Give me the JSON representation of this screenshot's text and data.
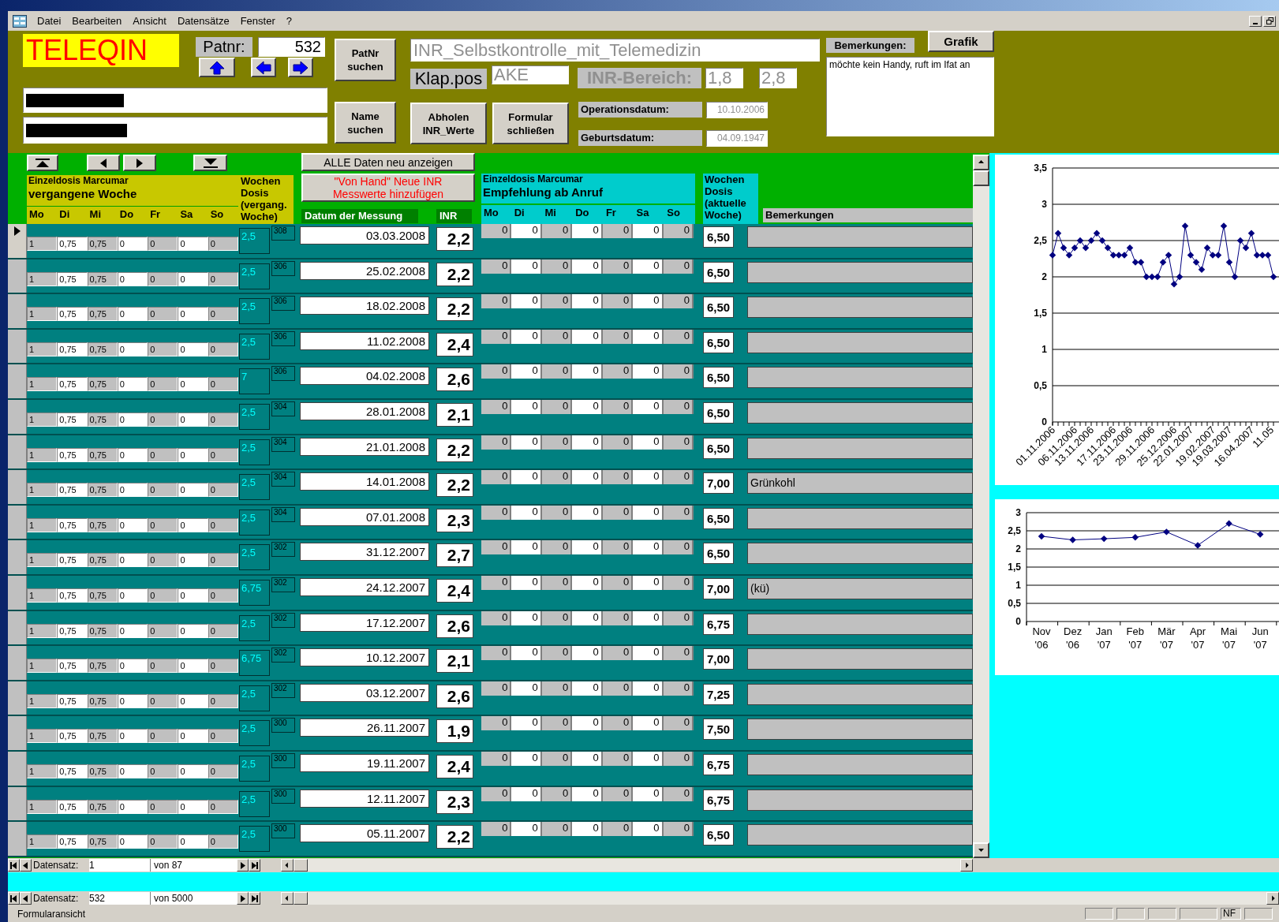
{
  "menu": [
    "Datei",
    "Bearbeiten",
    "Ansicht",
    "Datensätze",
    "Fenster",
    "?"
  ],
  "header": {
    "logo": "TELEQIN",
    "patnr_label": "Patnr:",
    "patnr": "532",
    "patnr_search": "PatNr suchen",
    "name_search": "Name suchen",
    "title": "INR_Selbstkontrolle_mit_Telemedizin",
    "klap_label": "Klap.pos",
    "klap": "AKE",
    "inr_range_label": "INR-Bereich:",
    "inr_min": "1,8",
    "inr_max": "2,8",
    "fetch_button": "Abholen INR_Werte",
    "close_button": "Formular schließen",
    "op_date_label": "Operationsdatum:",
    "op_date": "10.10.2006",
    "birth_label": "Geburtsdatum:",
    "birth_date": "04.09.1947",
    "remarks_label": "Bemerkungen:",
    "chart_button": "Grafik",
    "remarks": "möchte kein Handy, ruft im Ifat an"
  },
  "subform": {
    "show_all_button": "ALLE Daten neu anzeigen",
    "manual_button": "\"Von Hand\" Neue INR\nMesswerte  hinzufügen",
    "past_title": "Einzeldosis Marcumar",
    "past_subtitle": "vergangene Woche",
    "past_days": [
      "Mo",
      "Di",
      "Mi",
      "Do",
      "Fr",
      "Sa",
      "So"
    ],
    "weekly_past_header": "Wochen\nDosis\n(vergang.\nWoche)",
    "date_header": "Datum der Messung",
    "inr_header": "INR",
    "rec_title": "Einzeldosis Marcumar",
    "rec_subtitle": "Empfehlung ab Anruf",
    "rec_days": [
      "Mo",
      "Di",
      "Mi",
      "Do",
      "Fr",
      "Sa",
      "So"
    ],
    "weekly_header": "Wochen\nDosis\n(aktuelle\nWoche)",
    "remarks_header": "Bemerkungen",
    "rows": [
      {
        "selected": true,
        "past": [
          "1",
          "0,75",
          "0,75",
          "0",
          "0",
          "0",
          "0"
        ],
        "weekly_past": "2,5",
        "week_no": "308",
        "date": "03.03.2008",
        "inr": "2,2",
        "recommended": [
          "0",
          "0",
          "0",
          "0",
          "0",
          "0",
          "0"
        ],
        "weekly": "6,50"
      },
      {
        "selected": false,
        "past": [
          "1",
          "0,75",
          "0,75",
          "0",
          "0",
          "0",
          "0"
        ],
        "weekly_past": "2,5",
        "week_no": "306",
        "date": "25.02.2008",
        "inr": "2,2",
        "recommended": [
          "0",
          "0",
          "0",
          "0",
          "0",
          "0",
          "0"
        ],
        "weekly": "6,50"
      },
      {
        "selected": false,
        "past": [
          "1",
          "0,75",
          "0,75",
          "0",
          "0",
          "0",
          "0"
        ],
        "weekly_past": "2,5",
        "week_no": "306",
        "date": "18.02.2008",
        "inr": "2,2",
        "recommended": [
          "0",
          "0",
          "0",
          "0",
          "0",
          "0",
          "0"
        ],
        "weekly": "6,50"
      },
      {
        "selected": false,
        "past": [
          "1",
          "0,75",
          "0,75",
          "0",
          "0",
          "0",
          "0"
        ],
        "weekly_past": "2,5",
        "week_no": "306",
        "date": "11.02.2008",
        "inr": "2,4",
        "recommended": [
          "0",
          "0",
          "0",
          "0",
          "0",
          "0",
          "0"
        ],
        "weekly": "6,50"
      },
      {
        "selected": false,
        "past": [
          "1",
          "0,75",
          "0,75",
          "0",
          "0",
          "0",
          "0"
        ],
        "weekly_past": "7",
        "week_no": "306",
        "date": "04.02.2008",
        "inr": "2,6",
        "recommended": [
          "0",
          "0",
          "0",
          "0",
          "0",
          "0",
          "0"
        ],
        "weekly": "6,50"
      },
      {
        "selected": false,
        "past": [
          "1",
          "0,75",
          "0,75",
          "0",
          "0",
          "0",
          "0"
        ],
        "weekly_past": "2,5",
        "week_no": "304",
        "date": "28.01.2008",
        "inr": "2,1",
        "recommended": [
          "0",
          "0",
          "0",
          "0",
          "0",
          "0",
          "0"
        ],
        "weekly": "6,50"
      },
      {
        "selected": false,
        "past": [
          "1",
          "0,75",
          "0,75",
          "0",
          "0",
          "0",
          "0"
        ],
        "weekly_past": "2,5",
        "week_no": "304",
        "date": "21.01.2008",
        "inr": "2,2",
        "recommended": [
          "0",
          "0",
          "0",
          "0",
          "0",
          "0",
          "0"
        ],
        "weekly": "6,50"
      },
      {
        "selected": false,
        "past": [
          "1",
          "0,75",
          "0,75",
          "0",
          "0",
          "0",
          "0"
        ],
        "weekly_past": "2,5",
        "week_no": "304",
        "date": "14.01.2008",
        "inr": "2,2",
        "recommended": [
          "0",
          "0",
          "0",
          "0",
          "0",
          "0",
          "0"
        ],
        "weekly": "7,00",
        "remark": "Grünkohl"
      },
      {
        "selected": false,
        "past": [
          "1",
          "0,75",
          "0,75",
          "0",
          "0",
          "0",
          "0"
        ],
        "weekly_past": "2,5",
        "week_no": "304",
        "date": "07.01.2008",
        "inr": "2,3",
        "recommended": [
          "0",
          "0",
          "0",
          "0",
          "0",
          "0",
          "0"
        ],
        "weekly": "6,50"
      },
      {
        "selected": false,
        "past": [
          "1",
          "0,75",
          "0,75",
          "0",
          "0",
          "0",
          "0"
        ],
        "weekly_past": "2,5",
        "week_no": "302",
        "date": "31.12.2007",
        "inr": "2,7",
        "recommended": [
          "0",
          "0",
          "0",
          "0",
          "0",
          "0",
          "0"
        ],
        "weekly": "6,50"
      },
      {
        "selected": false,
        "past": [
          "1",
          "0,75",
          "0,75",
          "0",
          "0",
          "0",
          "0"
        ],
        "weekly_past": "6,75",
        "week_no": "302",
        "date": "24.12.2007",
        "inr": "2,4",
        "recommended": [
          "0",
          "0",
          "0",
          "0",
          "0",
          "0",
          "0"
        ],
        "weekly": "7,00",
        "remark": "(kü)"
      },
      {
        "selected": false,
        "past": [
          "1",
          "0,75",
          "0,75",
          "0",
          "0",
          "0",
          "0"
        ],
        "weekly_past": "2,5",
        "week_no": "302",
        "date": "17.12.2007",
        "inr": "2,6",
        "recommended": [
          "0",
          "0",
          "0",
          "0",
          "0",
          "0",
          "0"
        ],
        "weekly": "6,75"
      },
      {
        "selected": false,
        "past": [
          "1",
          "0,75",
          "0,75",
          "0",
          "0",
          "0",
          "0"
        ],
        "weekly_past": "6,75",
        "week_no": "302",
        "date": "10.12.2007",
        "inr": "2,1",
        "recommended": [
          "0",
          "0",
          "0",
          "0",
          "0",
          "0",
          "0"
        ],
        "weekly": "7,00"
      },
      {
        "selected": false,
        "past": [
          "1",
          "0,75",
          "0,75",
          "0",
          "0",
          "0",
          "0"
        ],
        "weekly_past": "2,5",
        "week_no": "302",
        "date": "03.12.2007",
        "inr": "2,6",
        "recommended": [
          "0",
          "0",
          "0",
          "0",
          "0",
          "0",
          "0"
        ],
        "weekly": "7,25"
      },
      {
        "selected": false,
        "past": [
          "1",
          "0,75",
          "0,75",
          "0",
          "0",
          "0",
          "0"
        ],
        "weekly_past": "2,5",
        "week_no": "300",
        "date": "26.11.2007",
        "inr": "1,9",
        "recommended": [
          "0",
          "0",
          "0",
          "0",
          "0",
          "0",
          "0"
        ],
        "weekly": "7,50"
      },
      {
        "selected": false,
        "past": [
          "1",
          "0,75",
          "0,75",
          "0",
          "0",
          "0",
          "0"
        ],
        "weekly_past": "2,5",
        "week_no": "300",
        "date": "19.11.2007",
        "inr": "2,4",
        "recommended": [
          "0",
          "0",
          "0",
          "0",
          "0",
          "0",
          "0"
        ],
        "weekly": "6,75"
      },
      {
        "selected": false,
        "past": [
          "1",
          "0,75",
          "0,75",
          "0",
          "0",
          "0",
          "0"
        ],
        "weekly_past": "2,5",
        "week_no": "300",
        "date": "12.11.2007",
        "inr": "2,3",
        "recommended": [
          "0",
          "0",
          "0",
          "0",
          "0",
          "0",
          "0"
        ],
        "weekly": "6,75"
      },
      {
        "selected": false,
        "past": [
          "1",
          "0,75",
          "0,75",
          "0",
          "0",
          "0",
          "0"
        ],
        "weekly_past": "2,5",
        "week_no": "300",
        "date": "05.11.2007",
        "inr": "2,2",
        "recommended": [
          "0",
          "0",
          "0",
          "0",
          "0",
          "0",
          "0"
        ],
        "weekly": "6,50"
      }
    ],
    "nav": {
      "label": "Datensatz:",
      "record": "1",
      "of": "von 87"
    }
  },
  "charts": [
    {
      "chart_data": {
        "type": "line",
        "grid": true,
        "ylim": [
          0,
          3.5
        ],
        "yticks": [
          {
            "value": 0,
            "label": "0"
          },
          {
            "value": 0.5,
            "label": "0,5"
          },
          {
            "value": 1,
            "label": "1"
          },
          {
            "value": 1.5,
            "label": "1,5"
          },
          {
            "value": 2,
            "label": "2"
          },
          {
            "value": 2.5,
            "label": "2,5"
          },
          {
            "value": 3,
            "label": "3"
          },
          {
            "value": 3.5,
            "label": "3,5"
          }
        ],
        "categories": [
          "01.11.2006",
          null,
          null,
          null,
          "06.11.2006",
          null,
          null,
          "13.11.2006",
          null,
          null,
          null,
          "17.11.2006",
          null,
          null,
          "23.11.2006",
          null,
          null,
          null,
          "29.11.2006",
          null,
          null,
          null,
          "25.12.2006",
          null,
          null,
          "22.01.2007",
          null,
          null,
          null,
          "19.02.2007",
          null,
          null,
          "19.03.2007",
          null,
          null,
          null,
          "16.04.2007",
          null,
          null,
          null,
          "11.05"
        ],
        "series": [
          {
            "color": "#000080",
            "marker": "diamond",
            "values": [
              2.3,
              2.6,
              2.4,
              2.3,
              2.4,
              2.5,
              2.4,
              2.5,
              2.6,
              2.5,
              2.4,
              2.3,
              2.3,
              2.3,
              2.4,
              2.2,
              2.2,
              2.0,
              2.0,
              2.0,
              2.2,
              2.3,
              1.9,
              2.0,
              2.7,
              2.3,
              2.2,
              2.1,
              2.4,
              2.3,
              2.3,
              2.7,
              2.2,
              2.0,
              2.5,
              2.4,
              2.6,
              2.3,
              2.3,
              2.3,
              2.0
            ]
          }
        ]
      }
    },
    {
      "chart_data": {
        "type": "line",
        "grid": true,
        "categories": [
          "Nov '06",
          "Dez '06",
          "Jan '07",
          "Feb '07",
          "Mär '07",
          "Apr '07",
          "Mai '07",
          "Jun '07"
        ],
        "ylim": [
          0,
          3
        ],
        "yticks": [
          {
            "value": 0,
            "label": "0"
          },
          {
            "value": 0.5,
            "label": "0,5"
          },
          {
            "value": 1,
            "label": "1"
          },
          {
            "value": 1.5,
            "label": "1,5"
          },
          {
            "value": 2,
            "label": "2"
          },
          {
            "value": 2.5,
            "label": "2,5"
          },
          {
            "value": 3,
            "label": "3"
          }
        ],
        "series": [
          {
            "color": "#000080",
            "marker": "diamond",
            "values": [
              2.35,
              2.25,
              2.28,
              2.32,
              2.47,
              2.1,
              2.7,
              2.4
            ]
          }
        ]
      }
    }
  ],
  "nav": {
    "label": "Datensatz:",
    "record": "532",
    "of": "von 5000"
  },
  "status": {
    "text": "Formularansicht",
    "indicator": "NF"
  }
}
